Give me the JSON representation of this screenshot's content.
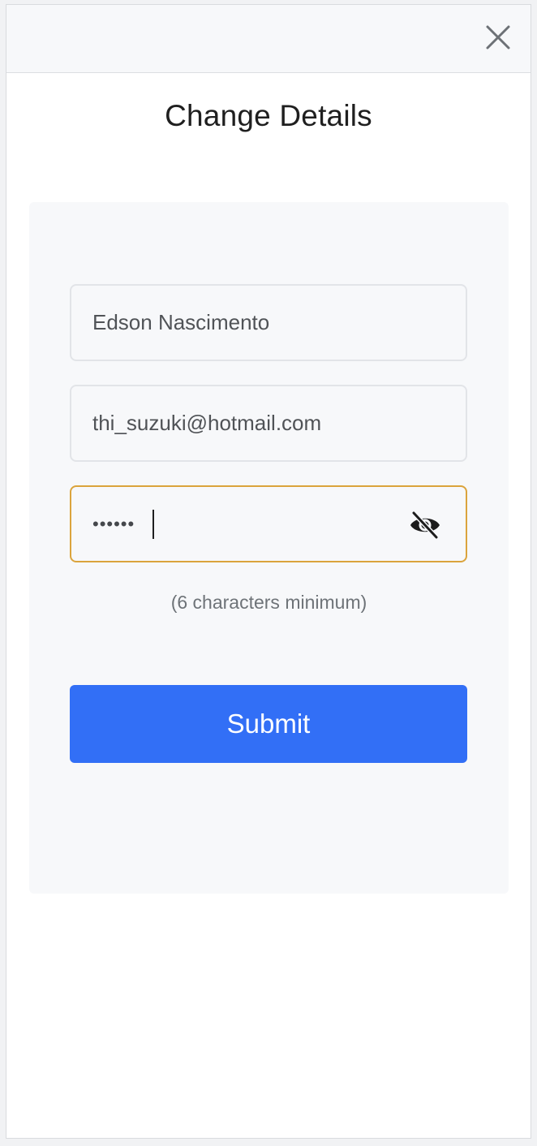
{
  "header": {
    "close_icon": "close-icon"
  },
  "title": "Change Details",
  "form": {
    "name_value": "Edson Nascimento",
    "email_value": "thi_suzuki@hotmail.com",
    "password_value": "••••••",
    "password_toggle_icon": "eye-slash-icon",
    "hint": "(6 characters minimum)",
    "submit_label": "Submit"
  },
  "colors": {
    "accent": "#326ff6",
    "focus_border": "#dba43c",
    "card_background": "#f7f8fa"
  }
}
